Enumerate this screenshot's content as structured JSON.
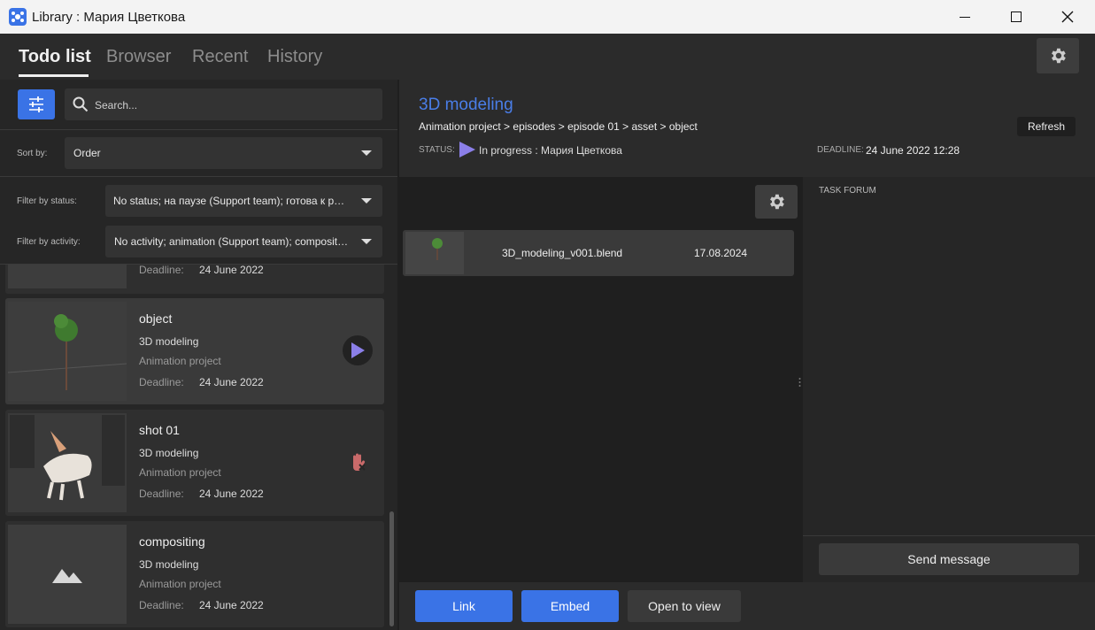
{
  "window": {
    "title": "Library : Мария Цветкова"
  },
  "tabs": [
    {
      "label": "Todo list"
    },
    {
      "label": "Browser"
    },
    {
      "label": "Recent"
    },
    {
      "label": "History"
    }
  ],
  "search": {
    "placeholder": "Search..."
  },
  "sort": {
    "label": "Sort by:",
    "value": "Order"
  },
  "filters": {
    "status_label": "Filter by status:",
    "status_value": "No status; на паузе (Support team); готова к работе (Support team); in progress",
    "activity_label": "Filter by activity:",
    "activity_value": "No activity; animation (Support team); compositing (Support team)"
  },
  "tasks": [
    {
      "deadline_label": "Deadline:",
      "deadline": "24 June 2022"
    },
    {
      "title": "object",
      "task": "3D modeling",
      "project": "Animation project",
      "deadline_label": "Deadline:",
      "deadline": "24 June 2022",
      "icon": "play-icon"
    },
    {
      "title": "shot 01",
      "task": "3D modeling",
      "project": "Animation project",
      "deadline_label": "Deadline:",
      "deadline": "24 June 2022",
      "icon": "hand-stop-icon"
    },
    {
      "title": "compositing",
      "task": "3D modeling",
      "project": "Animation project",
      "deadline_label": "Deadline:",
      "deadline": "24 June 2022",
      "icon": "image-placeholder-icon"
    }
  ],
  "detail": {
    "title": "3D modeling",
    "breadcrumb": "Animation project > episodes > episode 01 > asset > object",
    "refresh": "Refresh",
    "status_label": "STATUS:",
    "status_value": "In progress : Мария Цветкова",
    "deadline_label": "DEADLINE:",
    "deadline_value": "24 June 2022 12:28"
  },
  "files": [
    {
      "name": "3D_modeling_v001.blend",
      "date": "17.08.2024"
    }
  ],
  "forum": {
    "label": "TASK FORUM",
    "send": "Send message"
  },
  "actions": {
    "link": "Link",
    "embed": "Embed",
    "open": "Open to view"
  },
  "colors": {
    "accent": "#3a73e6",
    "title_blue": "#4a7ee8",
    "status_purple": "#8b7fe8",
    "stop_red": "#c96a6a"
  }
}
